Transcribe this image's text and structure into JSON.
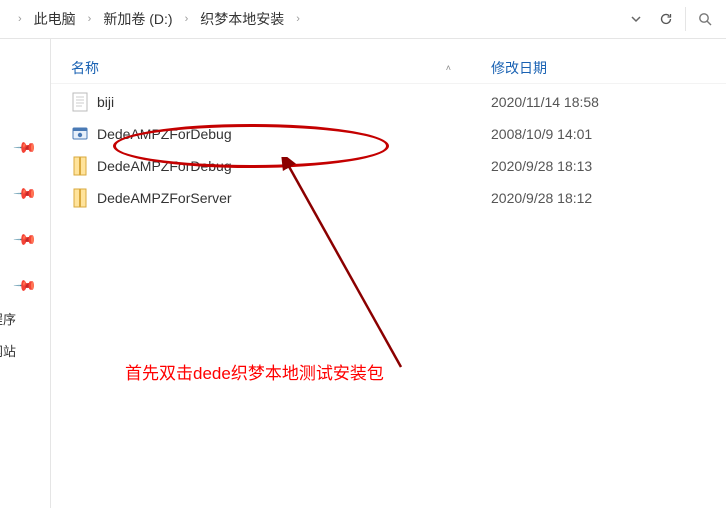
{
  "breadcrumb": {
    "items": [
      "此电脑",
      "新加卷 (D:)",
      "织梦本地安装"
    ]
  },
  "columns": {
    "name": "名称",
    "date": "修改日期"
  },
  "files": [
    {
      "icon": "text",
      "name": "biji",
      "date": "2020/11/14 18:58"
    },
    {
      "icon": "exe",
      "name": "DedeAMPZForDebug",
      "date": "2008/10/9 14:01"
    },
    {
      "icon": "zip",
      "name": "DedeAMPZForDebug",
      "date": "2020/9/28 18:13"
    },
    {
      "icon": "zip",
      "name": "DedeAMPZForServer",
      "date": "2020/9/28 18:12"
    }
  ],
  "sidebar": {
    "label1": "程序",
    "label2": "网站"
  },
  "annotation": "首先双击dede织梦本地测试安装包"
}
